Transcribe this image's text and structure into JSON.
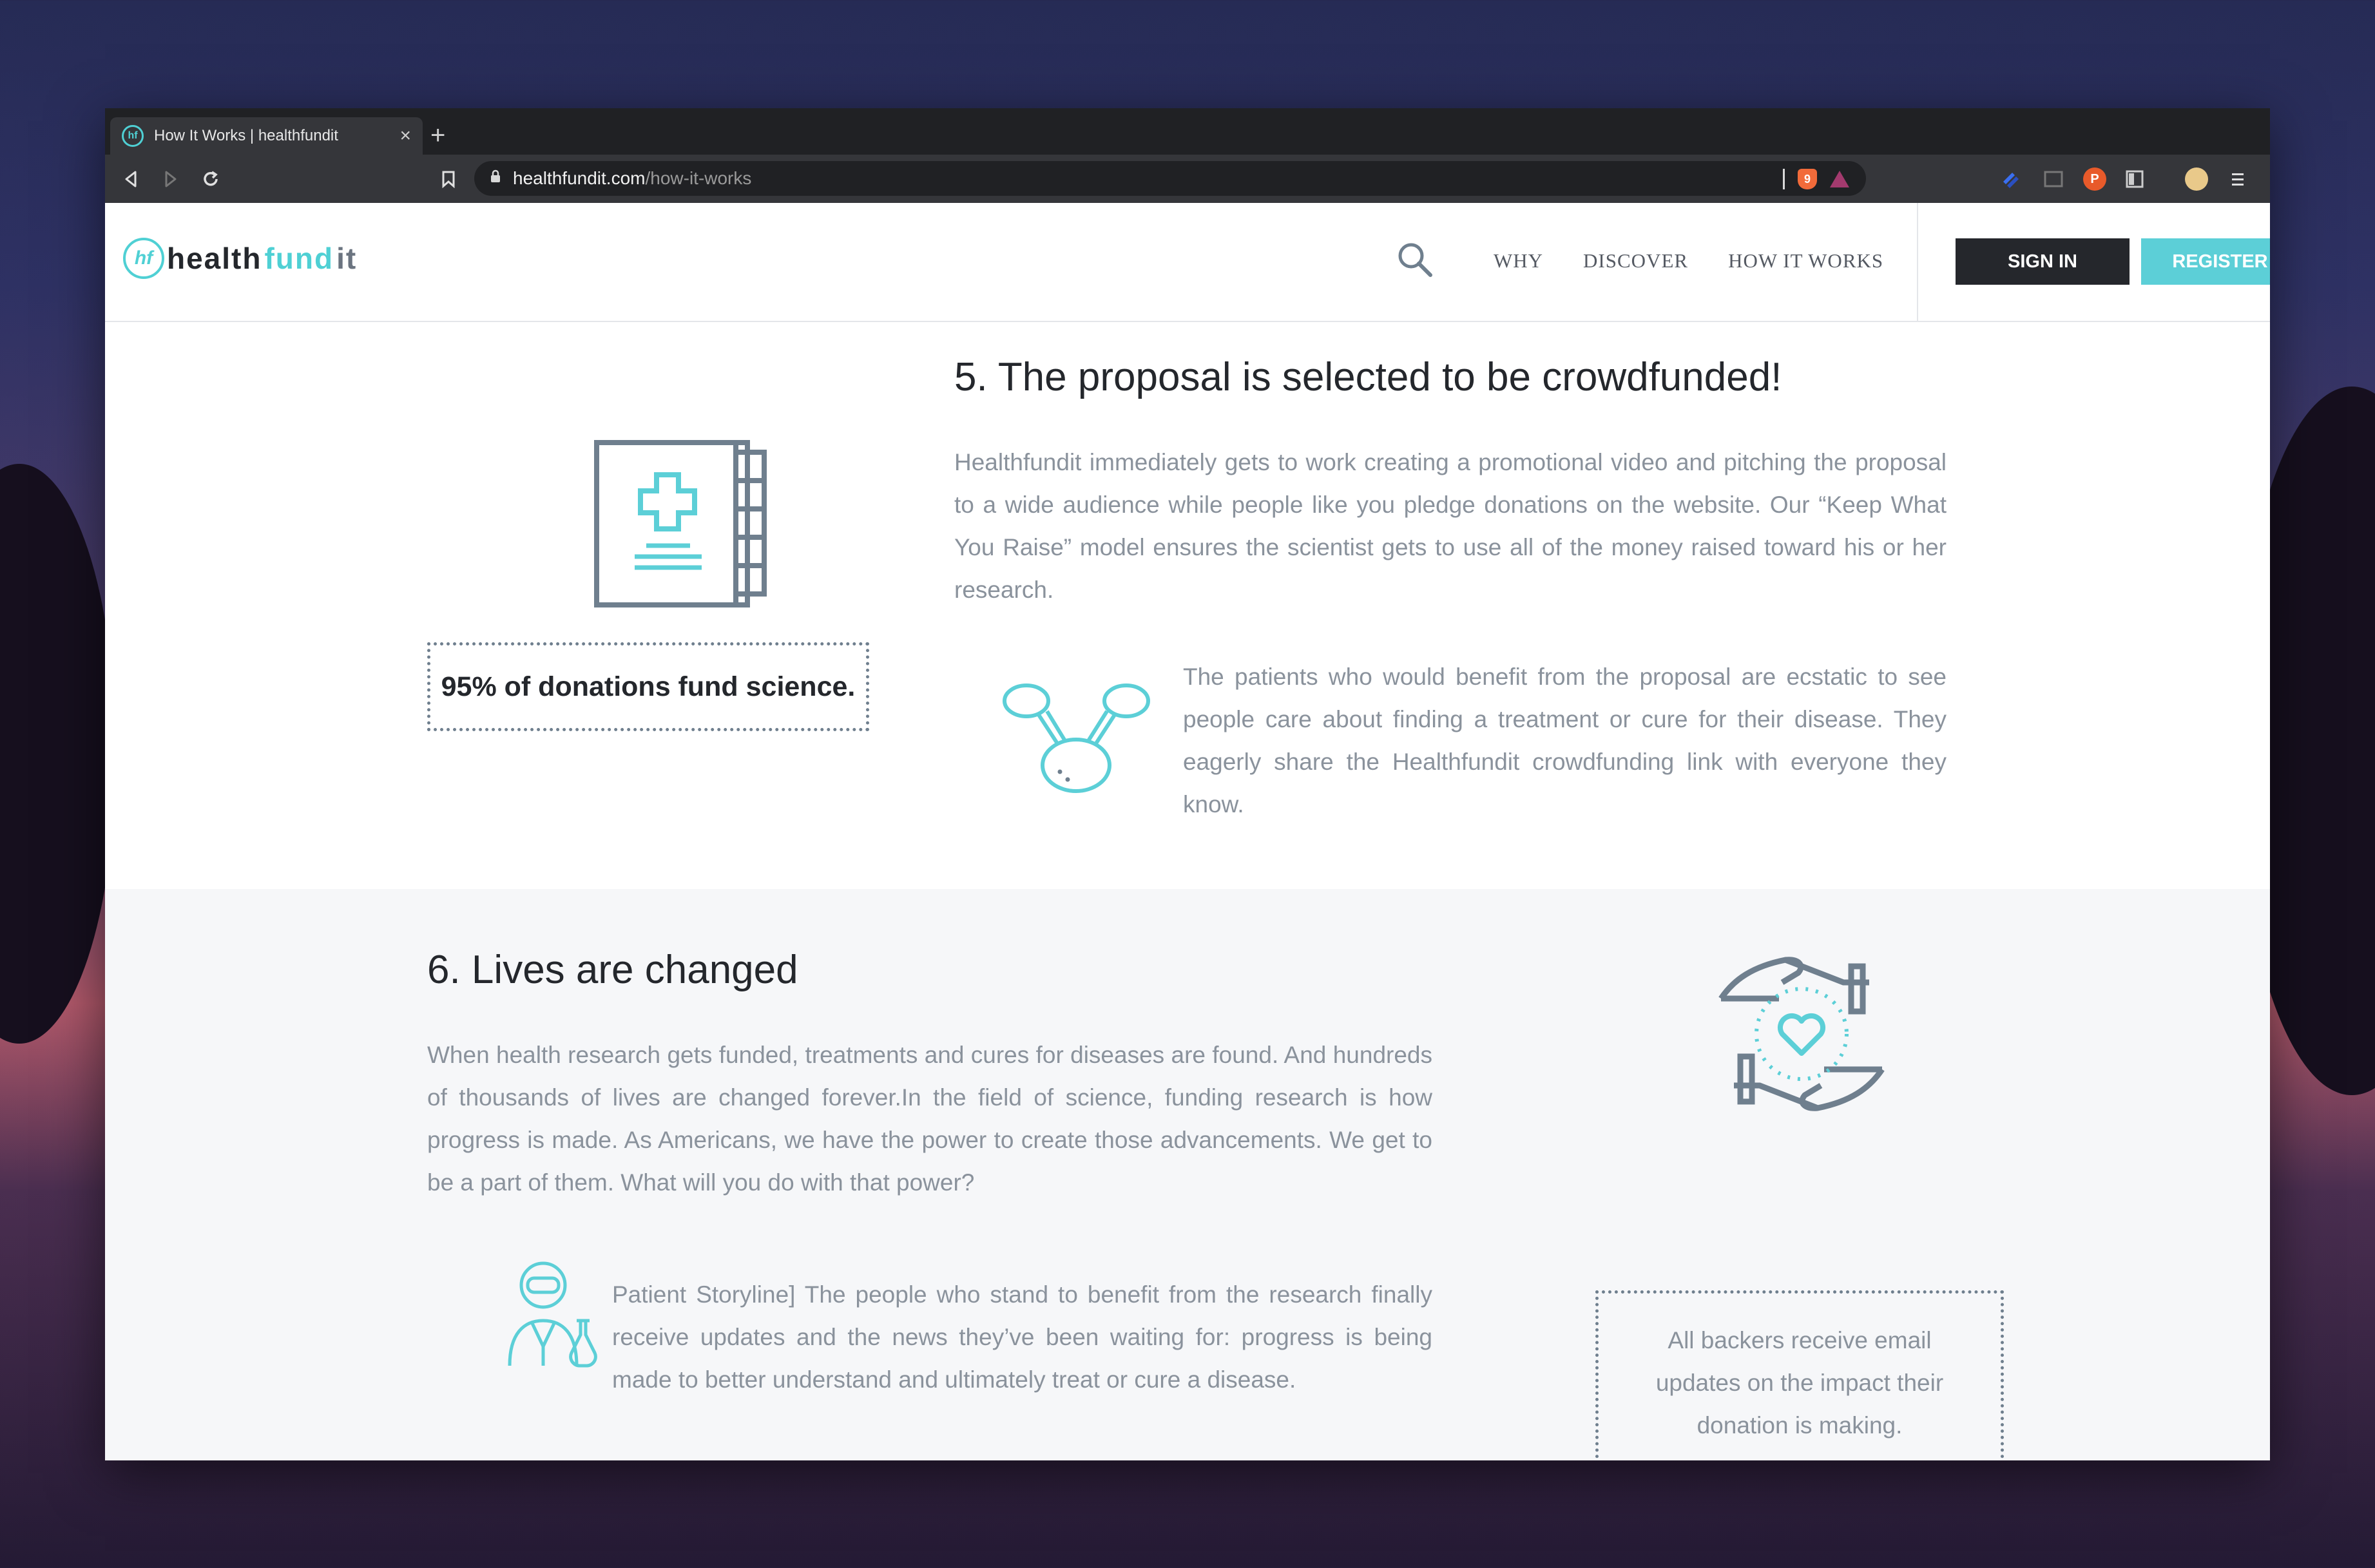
{
  "browser": {
    "tab_title": "How It Works | healthfundit",
    "tab_close": "×",
    "new_tab": "+",
    "url_host": "healthfundit.com",
    "url_path": "/how-it-works",
    "brave_badge": "9"
  },
  "site": {
    "logo": {
      "mark": "hf",
      "part1": "health",
      "part2": "fund",
      "part3": "it"
    },
    "nav": [
      "WHY",
      "DISCOVER",
      "HOW IT WORKS"
    ],
    "sign_in": "SIGN IN",
    "register": "REGISTER"
  },
  "section5": {
    "title": "5. The proposal is selected to be crowdfunded!",
    "paragraph": "Healthfundit immediately gets to work creating a promotional video and pitching the proposal to a wide audience while people like you pledge donations on the website. Our “Keep What You Raise” model ensures the scientist gets to use all of the money raised toward his or her research.",
    "callout": "95% of donations fund science.",
    "patients_text": "The patients who would benefit from the proposal are ecstatic to see people care about finding a treatment or cure for their disease. They eagerly share the Healthfundit crowdfunding link with everyone they know."
  },
  "section6": {
    "title": "6. Lives are changed",
    "paragraph": "When health research gets funded, treatments and cures for diseases are found. And hundreds of thousands of lives are changed forever.In the field of science, funding research is how progress is made. As Americans, we have the power to create those advancements. We get to be a part of them. What will you do with that power?",
    "storyline": "Patient Storyline] The people who stand to benefit from the research finally receive updates and the news they’ve been waiting for: progress is being made to better understand and ultimately treat or cure a disease.",
    "callout": "All backers receive email updates on the impact their donation is making."
  },
  "colors": {
    "accent": "#5ccfd7",
    "icon_gray": "#6f7f8e",
    "dark": "#25272c",
    "text_muted": "#8a929c"
  }
}
